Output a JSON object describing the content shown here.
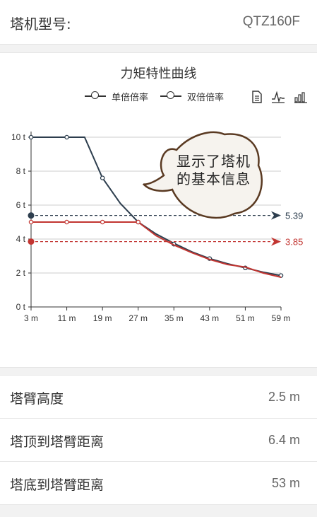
{
  "header": {
    "label": "塔机型号:",
    "value": "QTZ160F"
  },
  "chart_title": "力矩特性曲线",
  "legend": [
    {
      "name": "单倍倍率"
    },
    {
      "name": "双倍倍率"
    }
  ],
  "toolbar_icons": [
    "data-view-icon",
    "line-chart-icon",
    "bar-chart-icon"
  ],
  "bubble_text": "显示了塔机的基本信息",
  "chart_data": {
    "type": "line",
    "x": [
      3,
      11,
      19,
      27,
      35,
      43,
      51,
      59
    ],
    "x_tick_labels": [
      "3 m",
      "11 m",
      "19 m",
      "27 m",
      "35 m",
      "43 m",
      "51 m",
      "59 m"
    ],
    "y_tick_labels": [
      "0 t",
      "2 t",
      "4 t",
      "6 t",
      "8 t",
      "10 t"
    ],
    "ylim": [
      0,
      10
    ],
    "series": [
      {
        "name": "单倍倍率",
        "color": "#2d3e4e",
        "points": [
          [
            3,
            10
          ],
          [
            11,
            10
          ],
          [
            15,
            10
          ],
          [
            19,
            7.6
          ],
          [
            23,
            6.1
          ],
          [
            27,
            5.0
          ],
          [
            31,
            4.3
          ],
          [
            35,
            3.75
          ],
          [
            39,
            3.25
          ],
          [
            43,
            2.85
          ],
          [
            47,
            2.55
          ],
          [
            51,
            2.3
          ],
          [
            55,
            2.05
          ],
          [
            59,
            1.85
          ]
        ],
        "markers": [
          [
            3,
            10
          ],
          [
            11,
            10
          ],
          [
            19,
            7.6
          ],
          [
            27,
            5.0
          ],
          [
            35,
            3.7
          ],
          [
            43,
            2.85
          ],
          [
            51,
            2.3
          ],
          [
            59,
            1.85
          ]
        ]
      },
      {
        "name": "双倍倍率",
        "color": "#c23531",
        "points": [
          [
            3,
            5
          ],
          [
            11,
            5
          ],
          [
            19,
            5
          ],
          [
            27,
            5
          ],
          [
            31,
            4.2
          ],
          [
            35,
            3.65
          ],
          [
            39,
            3.2
          ],
          [
            43,
            2.8
          ],
          [
            47,
            2.5
          ],
          [
            51,
            2.35
          ],
          [
            55,
            2.0
          ],
          [
            59,
            1.75
          ]
        ],
        "markers": [
          [
            3,
            5
          ],
          [
            11,
            5
          ],
          [
            19,
            5
          ],
          [
            27,
            5
          ]
        ]
      }
    ],
    "reference_lines": [
      {
        "value": 5.39,
        "label": "5.39",
        "color": "#2d3e4e"
      },
      {
        "value": 3.85,
        "label": "3.85",
        "color": "#c23531"
      }
    ],
    "grid": true
  },
  "info_rows": [
    {
      "label": "塔臂高度",
      "value": "2.5 m"
    },
    {
      "label": "塔顶到塔臂距离",
      "value": "6.4 m"
    },
    {
      "label": "塔底到塔臂距离",
      "value": "53 m"
    }
  ]
}
